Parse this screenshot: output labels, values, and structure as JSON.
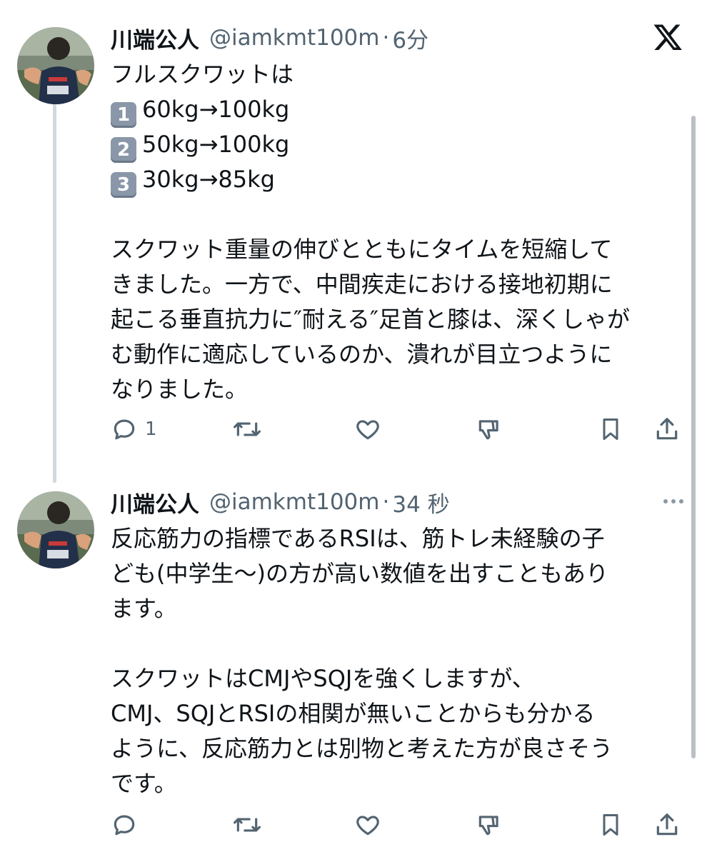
{
  "app": {
    "logo": "x-logo-icon",
    "colors": {
      "text": "#0f1419",
      "secondary": "#536471",
      "thread": "#cfd9de"
    }
  },
  "tweets": [
    {
      "author": {
        "name": "川端公人",
        "handle": "@iamkmt100m",
        "separator": "·",
        "time": "6分"
      },
      "text_lines": [
        "フルスクワットは",
        {
          "key": "1",
          "text": "60kg→100kg"
        },
        {
          "key": "2",
          "text": "50kg→100kg"
        },
        {
          "key": "3",
          "text": "30kg→85kg"
        },
        "",
        "スクワット重量の伸びとともにタイムを短縮して",
        "きました。一方で、中間疾走における接地初期に",
        "起こる垂直抗力に″耐える″足首と膝は、深くしゃが",
        "む動作に適応しているのか、潰れが目立つように",
        "なりました。"
      ],
      "actions": {
        "reply_count": "1",
        "icons": [
          "reply-icon",
          "retweet-icon",
          "like-icon",
          "dislike-icon",
          "bookmark-icon",
          "share-icon"
        ]
      }
    },
    {
      "author": {
        "name": "川端公人",
        "handle": "@iamkmt100m",
        "separator": "·",
        "time": "34 秒"
      },
      "text_lines": [
        "反応筋力の指標であるRSIは、筋トレ未経験の子",
        "ども(中学生〜)の方が高い数値を出すこともあり",
        "ます。",
        "",
        "スクワットはCMJやSQJを強くしますが、",
        "CMJ、SQJとRSIの相関が無いことからも分かる",
        "ように、反応筋力とは別物と考えた方が良さそう",
        "です。"
      ],
      "actions": {
        "reply_count": "",
        "icons": [
          "reply-icon",
          "retweet-icon",
          "like-icon",
          "dislike-icon",
          "bookmark-icon",
          "share-icon"
        ]
      }
    }
  ]
}
